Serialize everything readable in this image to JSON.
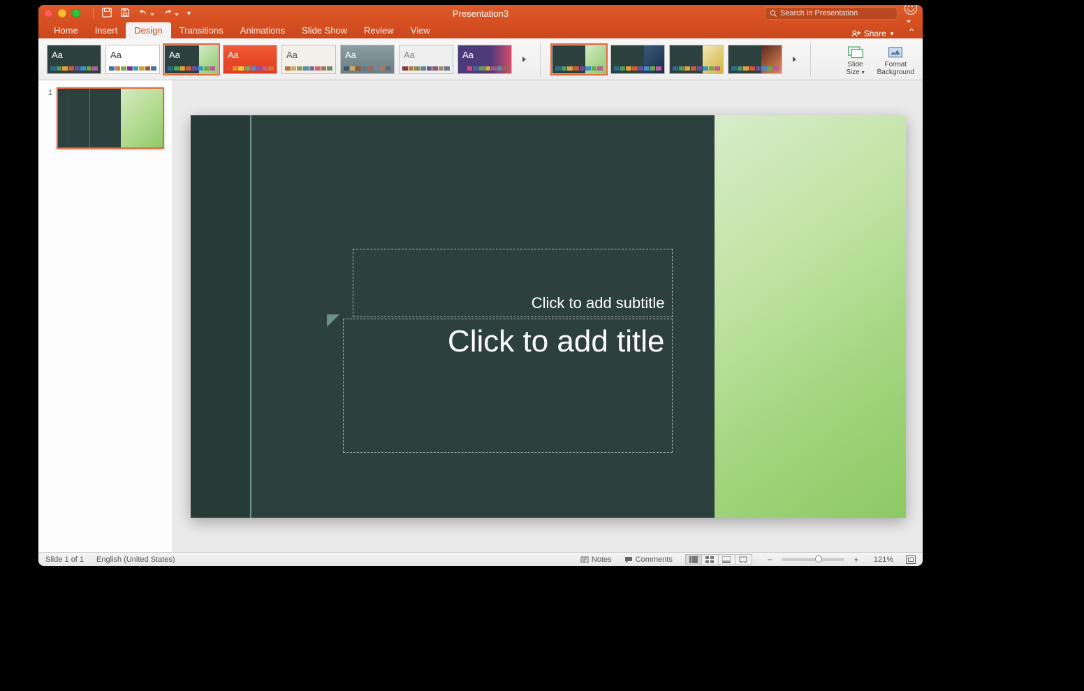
{
  "window_title": "Presentation3",
  "search_placeholder": "Search in Presentation",
  "tabs": [
    "Home",
    "Insert",
    "Design",
    "Transitions",
    "Animations",
    "Slide Show",
    "Review",
    "View"
  ],
  "active_tab": "Design",
  "share_label": "Share",
  "themes": [
    {
      "bg": "#2c413d",
      "aa_color": "#fff",
      "strip": [
        "#2d6b8e",
        "#4f9d5f",
        "#e2a23a",
        "#d15a3b",
        "#6d4fa0",
        "#3c8fc9",
        "#6aa84f",
        "#b55c9c"
      ],
      "selected": false,
      "accent": "none"
    },
    {
      "bg": "#ffffff",
      "aa_color": "#333",
      "strip": [
        "#3d6db5",
        "#d5773a",
        "#8aa54b",
        "#6a3e8f",
        "#3a9ea3",
        "#c9a23a",
        "#9c5a3a",
        "#4a6fa3"
      ],
      "selected": false,
      "accent": "none"
    },
    {
      "bg": "#2c413d",
      "aa_color": "#fff",
      "strip": [
        "#2d6b8e",
        "#4f9d5f",
        "#e2a23a",
        "#d15a3b",
        "#6d4fa0",
        "#3c8fc9",
        "#6aa84f",
        "#b55c9c"
      ],
      "selected": true,
      "accent": "green"
    },
    {
      "bg": "#e84a2e",
      "aa_color": "#fff",
      "strip": [
        "#e84a2e",
        "#f08c3a",
        "#f4c842",
        "#6fae5d",
        "#4a92c9",
        "#7a58b0",
        "#c95a8e",
        "#d0743a"
      ],
      "selected": false,
      "accent": "red"
    },
    {
      "bg": "#f3f0ea",
      "aa_color": "#555",
      "strip": [
        "#b0783a",
        "#d6a85a",
        "#8a9a5b",
        "#5a8ca3",
        "#7a6a9c",
        "#c96a6a",
        "#9a7a5a",
        "#6a8a6a"
      ],
      "selected": false,
      "accent": "none"
    },
    {
      "bg": "#7a8e94",
      "aa_color": "#fff",
      "strip": [
        "#3a5a6a",
        "#d6a85a",
        "#8a5a3a",
        "#5a7a8a",
        "#9a6a5a",
        "#6a8a9a",
        "#b07a5a",
        "#5a6a7a"
      ],
      "selected": false,
      "accent": "slate"
    },
    {
      "bg": "#efefef",
      "aa_color": "#888",
      "strip": [
        "#8a3a3a",
        "#b0783a",
        "#8a8a5a",
        "#5a8a8a",
        "#6a5a8a",
        "#8a5a7a",
        "#a08a6a",
        "#6a7a8a"
      ],
      "selected": false,
      "accent": "none"
    },
    {
      "bg": "#4d3a7a",
      "aa_color": "#fff",
      "strip": [
        "#4d3a7a",
        "#d64a6a",
        "#3a6a9a",
        "#6a9a5a",
        "#d6a83a",
        "#9a5a8a",
        "#5a8a9a",
        "#8a6a4a"
      ],
      "selected": false,
      "accent": "purple"
    }
  ],
  "variants": [
    {
      "grad": "linear-gradient(135deg,#d4e9c4,#8ec96c)",
      "selected": true
    },
    {
      "grad": "linear-gradient(135deg,#3a5a7a,#1a2a4a)",
      "selected": false
    },
    {
      "grad": "linear-gradient(135deg,#f4e8b8,#d0b43a)",
      "selected": false
    },
    {
      "grad": "linear-gradient(135deg,#5a2a1a,#e88a5a)",
      "selected": false
    }
  ],
  "controls": {
    "slide_size": "Slide\nSize",
    "format_bg": "Format\nBackground"
  },
  "slide": {
    "number": "1",
    "subtitle_placeholder": "Click to add subtitle",
    "title_placeholder": "Click to add title"
  },
  "status": {
    "slide_of": "Slide 1 of 1",
    "language": "English (United States)",
    "notes": "Notes",
    "comments": "Comments",
    "zoom": "121%"
  }
}
